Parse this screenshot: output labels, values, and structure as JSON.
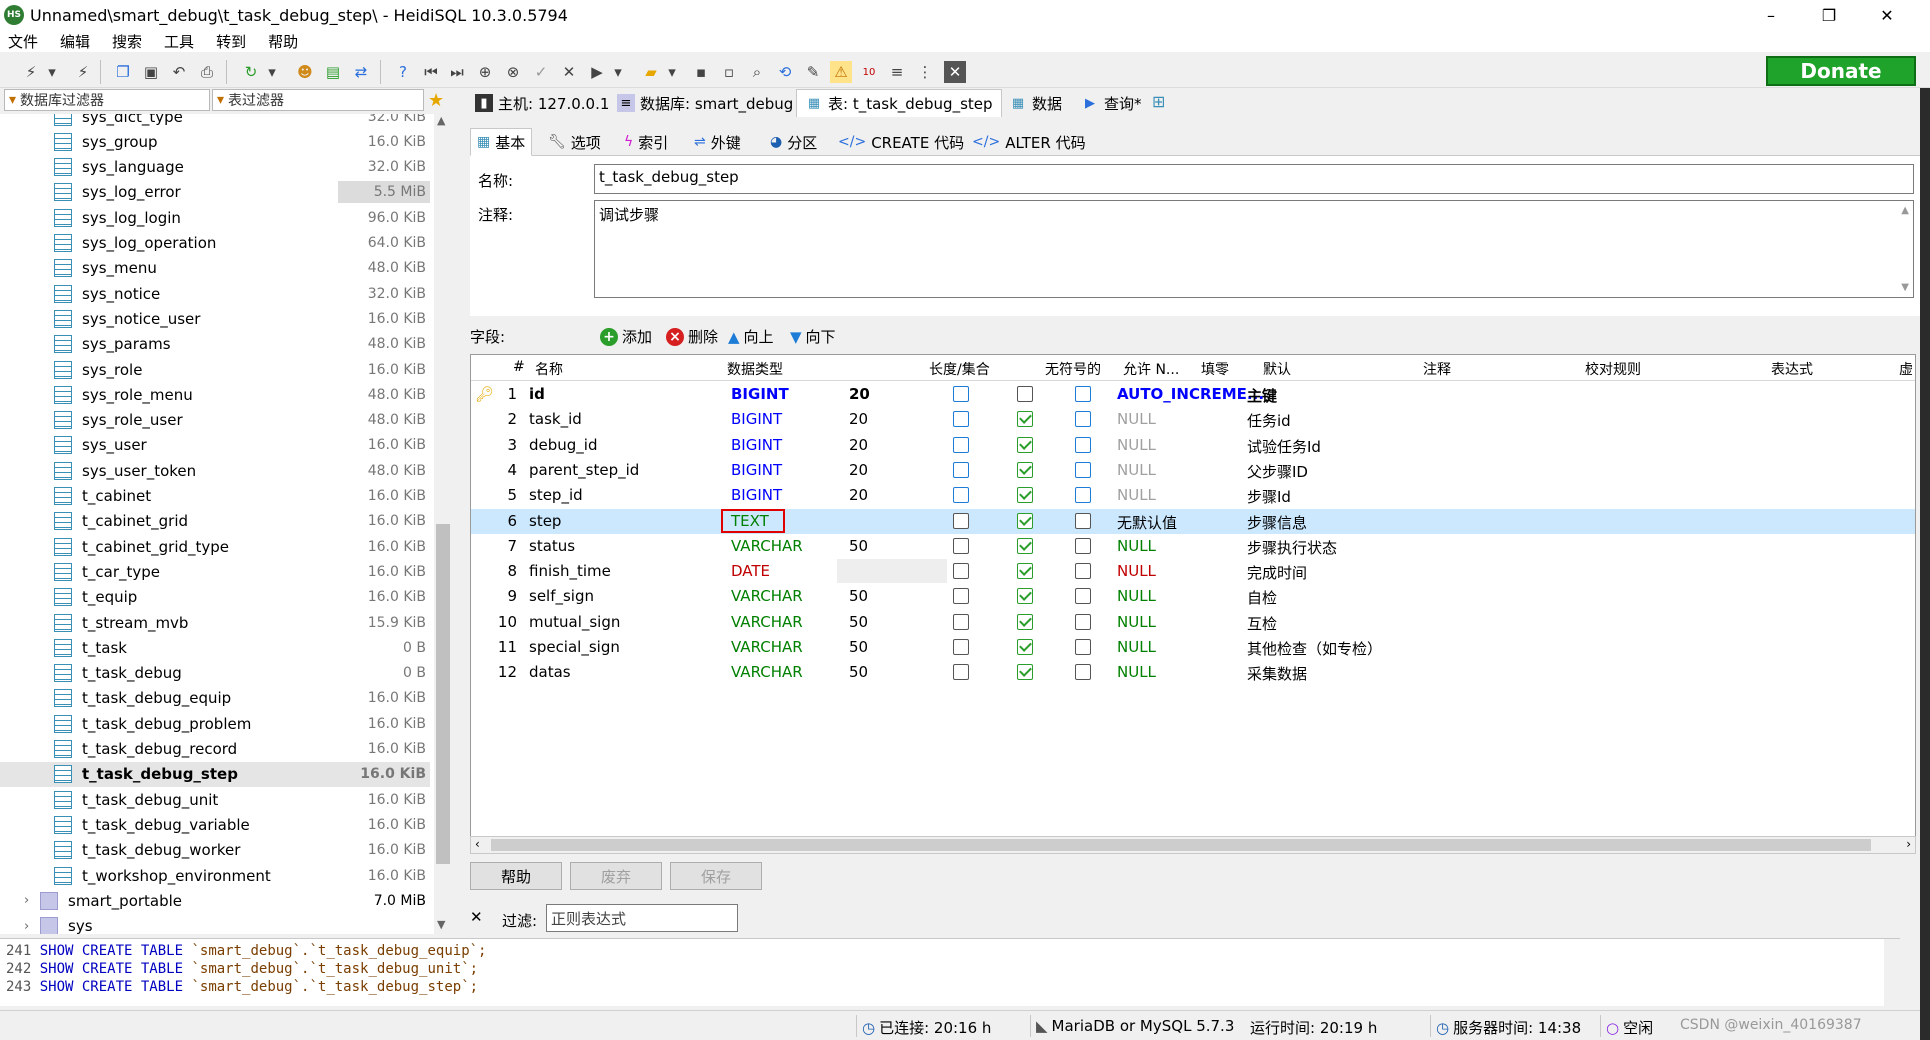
{
  "window": {
    "title": "Unnamed\\smart_debug\\t_task_debug_step\\ - HeidiSQL 10.3.0.5794",
    "app_icon": "HS",
    "minimize": "–",
    "maximize": "❐",
    "close": "✕"
  },
  "menu": [
    "文件",
    "编辑",
    "搜索",
    "工具",
    "转到",
    "帮助"
  ],
  "donate_label": "Donate",
  "filters": {
    "db_filter": "数据库过滤器",
    "table_filter": "表过滤器"
  },
  "top_tabs": [
    {
      "label": "主机: 127.0.0.1",
      "icon": "host-icon"
    },
    {
      "label": "数据库: smart_debug",
      "icon": "database-icon"
    },
    {
      "label": "表: t_task_debug_step",
      "icon": "table-icon"
    },
    {
      "label": "数据",
      "icon": "data-grid-icon"
    },
    {
      "label": "查询*",
      "icon": "query-play-icon"
    }
  ],
  "tree": {
    "tables": [
      {
        "name": "sys_dict_type",
        "size": "32.0 KiB"
      },
      {
        "name": "sys_group",
        "size": "16.0 KiB"
      },
      {
        "name": "sys_language",
        "size": "32.0 KiB"
      },
      {
        "name": "sys_log_error",
        "size": "5.5 MiB"
      },
      {
        "name": "sys_log_login",
        "size": "96.0 KiB"
      },
      {
        "name": "sys_log_operation",
        "size": "64.0 KiB"
      },
      {
        "name": "sys_menu",
        "size": "48.0 KiB"
      },
      {
        "name": "sys_notice",
        "size": "32.0 KiB"
      },
      {
        "name": "sys_notice_user",
        "size": "16.0 KiB"
      },
      {
        "name": "sys_params",
        "size": "48.0 KiB"
      },
      {
        "name": "sys_role",
        "size": "16.0 KiB"
      },
      {
        "name": "sys_role_menu",
        "size": "48.0 KiB"
      },
      {
        "name": "sys_role_user",
        "size": "48.0 KiB"
      },
      {
        "name": "sys_user",
        "size": "16.0 KiB"
      },
      {
        "name": "sys_user_token",
        "size": "48.0 KiB"
      },
      {
        "name": "t_cabinet",
        "size": "16.0 KiB"
      },
      {
        "name": "t_cabinet_grid",
        "size": "16.0 KiB"
      },
      {
        "name": "t_cabinet_grid_type",
        "size": "16.0 KiB"
      },
      {
        "name": "t_car_type",
        "size": "16.0 KiB"
      },
      {
        "name": "t_equip",
        "size": "16.0 KiB"
      },
      {
        "name": "t_stream_mvb",
        "size": "15.9 KiB"
      },
      {
        "name": "t_task",
        "size": "0 B"
      },
      {
        "name": "t_task_debug",
        "size": "0 B"
      },
      {
        "name": "t_task_debug_equip",
        "size": "16.0 KiB"
      },
      {
        "name": "t_task_debug_problem",
        "size": "16.0 KiB"
      },
      {
        "name": "t_task_debug_record",
        "size": "16.0 KiB"
      },
      {
        "name": "t_task_debug_step",
        "size": "16.0 KiB"
      },
      {
        "name": "t_task_debug_unit",
        "size": "16.0 KiB"
      },
      {
        "name": "t_task_debug_variable",
        "size": "16.0 KiB"
      },
      {
        "name": "t_task_debug_worker",
        "size": "16.0 KiB"
      },
      {
        "name": "t_workshop_environment",
        "size": "16.0 KiB"
      }
    ],
    "databases": [
      {
        "name": "smart_portable",
        "size": "7.0 MiB"
      },
      {
        "name": "sys",
        "size": ""
      }
    ]
  },
  "sub_tabs": [
    {
      "label": "基本",
      "icon": "table-icon"
    },
    {
      "label": "选项",
      "icon": "wrench-icon"
    },
    {
      "label": "索引",
      "icon": "lightning-icon"
    },
    {
      "label": "外键",
      "icon": "foreign-key-icon"
    },
    {
      "label": "分区",
      "icon": "pie-icon"
    },
    {
      "label": "CREATE 代码",
      "icon": "code-icon"
    },
    {
      "label": "ALTER 代码",
      "icon": "code-icon"
    }
  ],
  "basic": {
    "name_label": "名称:",
    "name_value": "t_task_debug_step",
    "comment_label": "注释:",
    "comment_value": "调试步骤"
  },
  "fields_bar": {
    "label": "字段:",
    "add": "添加",
    "delete": "删除",
    "up": "向上",
    "down": "向下"
  },
  "grid": {
    "headers": [
      "#",
      "名称",
      "数据类型",
      "长度/集合",
      "无符号的",
      "允许 N...",
      "填零",
      "默认",
      "注释",
      "校对规则",
      "表达式",
      "虚"
    ],
    "rows": [
      {
        "num": "1",
        "name": "id",
        "type": "BIGINT",
        "length": "20",
        "unsigned": false,
        "nullable": false,
        "zerofill": false,
        "default": "AUTO_INCREME...",
        "comment": "主键"
      },
      {
        "num": "2",
        "name": "task_id",
        "type": "BIGINT",
        "length": "20",
        "unsigned": false,
        "nullable": true,
        "zerofill": false,
        "default": "NULL",
        "comment": "任务id"
      },
      {
        "num": "3",
        "name": "debug_id",
        "type": "BIGINT",
        "length": "20",
        "unsigned": false,
        "nullable": true,
        "zerofill": false,
        "default": "NULL",
        "comment": "试验任务Id"
      },
      {
        "num": "4",
        "name": "parent_step_id",
        "type": "BIGINT",
        "length": "20",
        "unsigned": false,
        "nullable": true,
        "zerofill": false,
        "default": "NULL",
        "comment": "父步骤ID"
      },
      {
        "num": "5",
        "name": "step_id",
        "type": "BIGINT",
        "length": "20",
        "unsigned": false,
        "nullable": true,
        "zerofill": false,
        "default": "NULL",
        "comment": "步骤Id"
      },
      {
        "num": "6",
        "name": "step",
        "type": "TEXT",
        "length": "",
        "unsigned": false,
        "nullable": true,
        "zerofill": false,
        "default": "无默认值",
        "comment": "步骤信息"
      },
      {
        "num": "7",
        "name": "status",
        "type": "VARCHAR",
        "length": "50",
        "unsigned": false,
        "nullable": true,
        "zerofill": false,
        "default": "NULL",
        "comment": "步骤执行状态"
      },
      {
        "num": "8",
        "name": "finish_time",
        "type": "DATE",
        "length": "",
        "unsigned": false,
        "nullable": true,
        "zerofill": false,
        "default": "NULL",
        "comment": "完成时间"
      },
      {
        "num": "9",
        "name": "self_sign",
        "type": "VARCHAR",
        "length": "50",
        "unsigned": false,
        "nullable": true,
        "zerofill": false,
        "default": "NULL",
        "comment": "自检"
      },
      {
        "num": "10",
        "name": "mutual_sign",
        "type": "VARCHAR",
        "length": "50",
        "unsigned": false,
        "nullable": true,
        "zerofill": false,
        "default": "NULL",
        "comment": "互检"
      },
      {
        "num": "11",
        "name": "special_sign",
        "type": "VARCHAR",
        "length": "50",
        "unsigned": false,
        "nullable": true,
        "zerofill": false,
        "default": "NULL",
        "comment": "其他检查（如专检）"
      },
      {
        "num": "12",
        "name": "datas",
        "type": "VARCHAR",
        "length": "50",
        "unsigned": false,
        "nullable": true,
        "zerofill": false,
        "default": "NULL",
        "comment": "采集数据"
      }
    ]
  },
  "buttons": {
    "help": "帮助",
    "discard": "废弃",
    "save": "保存"
  },
  "filter_row": {
    "close": "✕",
    "label": "过滤:",
    "placeholder": "正则表达式"
  },
  "sql_log": [
    {
      "ln": "241",
      "kw": "SHOW CREATE TABLE",
      "arg": "`smart_debug`.`t_task_debug_equip`;"
    },
    {
      "ln": "242",
      "kw": "SHOW CREATE TABLE",
      "arg": "`smart_debug`.`t_task_debug_unit`;"
    },
    {
      "ln": "243",
      "kw": "SHOW CREATE TABLE",
      "arg": "`smart_debug`.`t_task_debug_step`;"
    }
  ],
  "status": {
    "connected": "已连接: 20:16 h",
    "server": "MariaDB or MySQL 5.7.3",
    "runtime": "运行时间: 20:19 h",
    "server_time": "服务器时间: 14:38",
    "idle": "空闲",
    "watermark": "CSDN @weixin_40169387"
  },
  "colors": {
    "donate": "#1fa32b",
    "type_int": "#0000ff",
    "type_text": "#008000",
    "type_date": "#c00000",
    "selected_row": "#cce8ff",
    "highlight_box": "#e00000"
  }
}
